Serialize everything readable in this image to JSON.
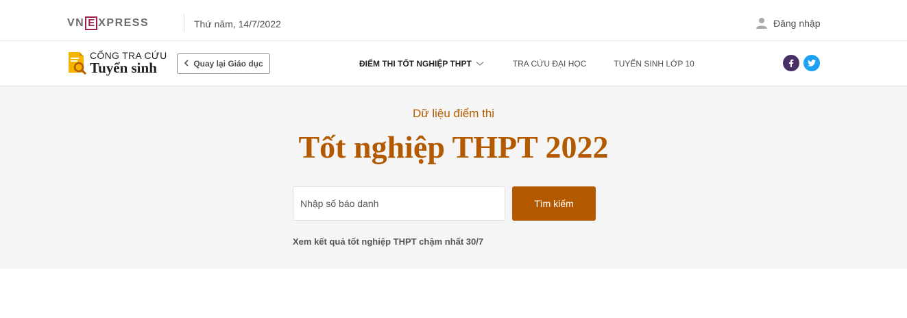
{
  "topbar": {
    "logo_prefix": "VN",
    "logo_box": "E",
    "logo_suffix": "XPRESS",
    "date": "Thứ năm, 14/7/2022",
    "login_label": "Đăng nhập",
    "login_icon": "user-icon"
  },
  "brand": {
    "line1": "CỔNG TRA CỨU",
    "line2": "Tuyển sinh",
    "icon": "document-search-icon"
  },
  "back_button": {
    "label": "Quay lại Giáo dục",
    "icon": "chevron-left-icon"
  },
  "nav": {
    "items": [
      {
        "label": "ĐIỂM THI TỐT NGHIỆP THPT",
        "active": true,
        "has_dropdown": true
      },
      {
        "label": "TRA CỨU ĐẠI HỌC",
        "active": false
      },
      {
        "label": "TUYỂN SINH LỚP 10",
        "active": false
      }
    ]
  },
  "social": {
    "facebook_color": "#4a2f67",
    "twitter_color": "#1da1f2"
  },
  "hero": {
    "subtitle": "Dữ liệu điểm thi",
    "title": "Tốt nghiệp THPT 2022",
    "search_placeholder": "Nhập số báo danh",
    "search_value": "",
    "search_button": "Tìm kiếm",
    "note": "Xem kết quả tốt nghiệp THPT chậm nhất 30/7"
  },
  "colors": {
    "accent": "#b35a00",
    "brand_red": "#9f224e",
    "icon_yellow": "#f5b400"
  }
}
